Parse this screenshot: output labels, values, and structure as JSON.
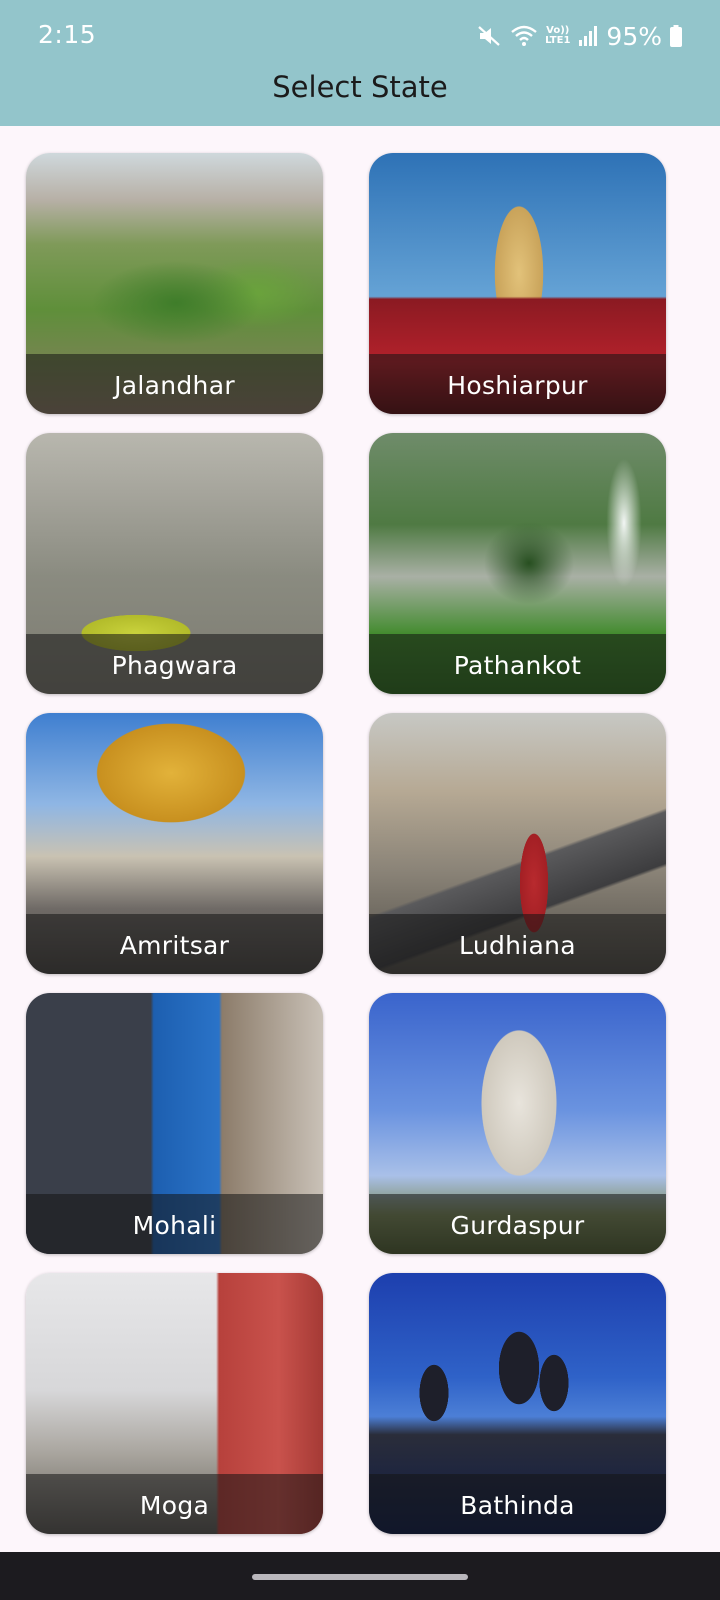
{
  "status_bar": {
    "time": "2:15",
    "volte_top": "Vo))",
    "volte_bottom": "LTE1",
    "battery": "95%",
    "icons": [
      "mute-icon",
      "wifi-icon",
      "volte-icon",
      "signal-icon",
      "battery-icon"
    ]
  },
  "header": {
    "title": "Select State",
    "background": "#93c5cb"
  },
  "cards": [
    {
      "label": "Jalandhar"
    },
    {
      "label": "Hoshiarpur"
    },
    {
      "label": "Phagwara"
    },
    {
      "label": "Pathankot"
    },
    {
      "label": "Amritsar"
    },
    {
      "label": "Ludhiana"
    },
    {
      "label": "Mohali"
    },
    {
      "label": "Gurdaspur"
    },
    {
      "label": "Moga"
    },
    {
      "label": "Bathinda"
    }
  ]
}
